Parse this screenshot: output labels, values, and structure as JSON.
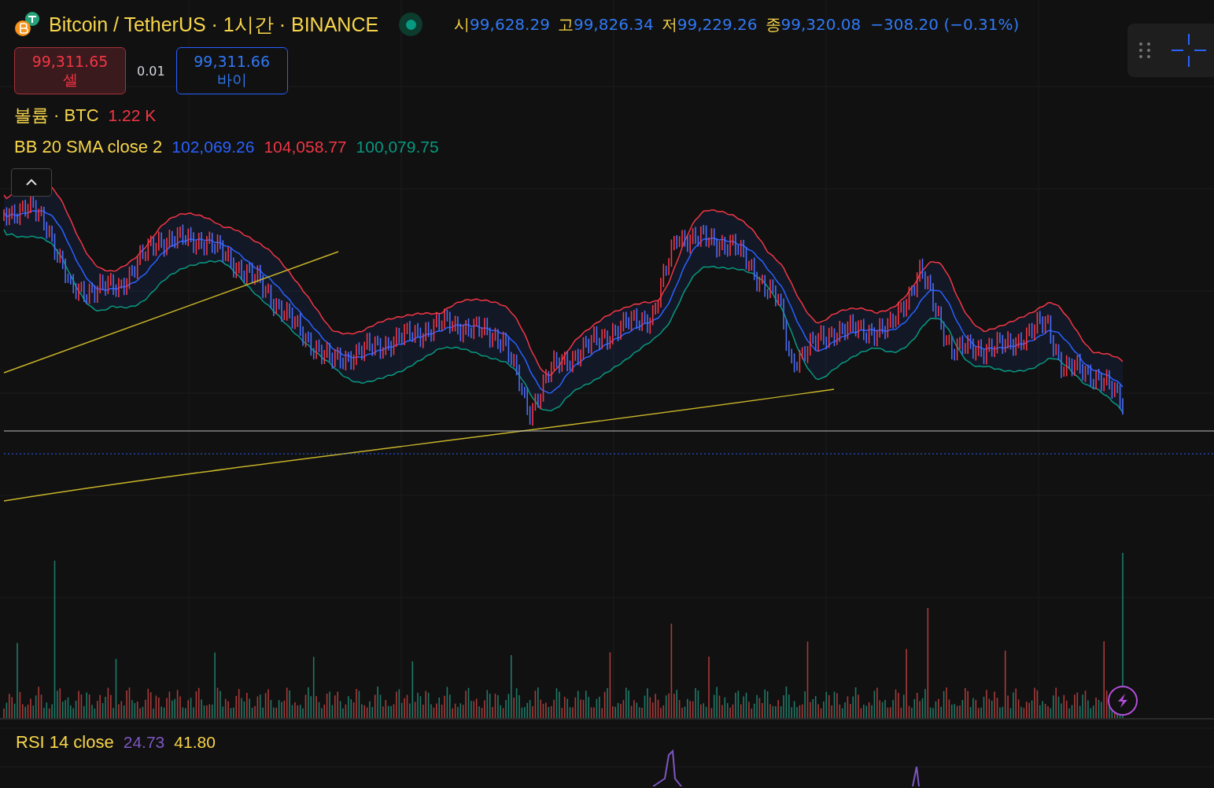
{
  "header": {
    "symbol": "Bitcoin / TetherUS · 1시간 · BINANCE",
    "market_open": true,
    "ohlc": [
      {
        "label": "시",
        "value": "99,628.29"
      },
      {
        "label": "고",
        "value": "99,826.34"
      },
      {
        "label": "저",
        "value": "99,229.26"
      },
      {
        "label": "종",
        "value": "99,320.08"
      }
    ],
    "change": "−308.20 (−0.31%)"
  },
  "trade": {
    "sell": {
      "price": "99,311.65",
      "label": "셀"
    },
    "spread": "0.01",
    "buy": {
      "price": "99,311.66",
      "label": "바이"
    }
  },
  "indicators": [
    {
      "name": "볼륨 · BTC",
      "values": [
        {
          "text": "1.22 K",
          "color": "#f23645"
        }
      ]
    },
    {
      "name": "BB 20 SMA close 2",
      "values": [
        {
          "text": "102,069.26",
          "color": "#2962ff"
        },
        {
          "text": "104,058.77",
          "color": "#f23645"
        },
        {
          "text": "100,079.75",
          "color": "#089981"
        }
      ]
    }
  ],
  "rsi": {
    "name": "RSI 14 close",
    "values": [
      {
        "text": "24.73",
        "color": "#7e57c2"
      },
      {
        "text": "41.80",
        "color": "#f7d54a"
      }
    ]
  }
}
